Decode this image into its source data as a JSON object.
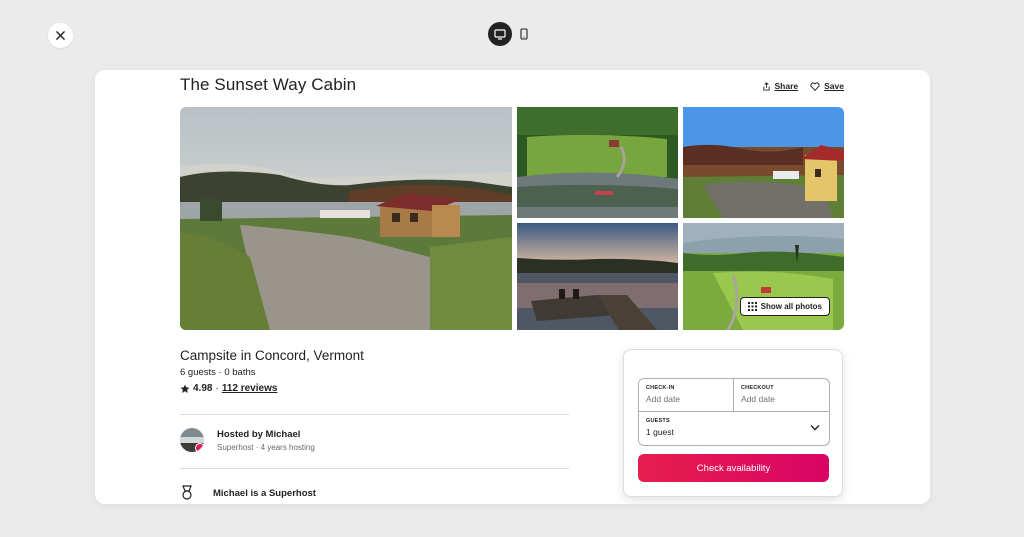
{
  "window": {
    "close_icon": "close-icon",
    "device_toggle": [
      {
        "icon": "desktop-icon",
        "active": true
      },
      {
        "icon": "mobile-icon",
        "active": false
      }
    ]
  },
  "listing": {
    "title": "The Sunset Way Cabin",
    "share_label": "Share",
    "save_label": "Save",
    "show_all_photos_label": "Show all photos",
    "subtitle": "Campsite in Concord, Vermont",
    "details": "6 guests · 0 baths",
    "rating_score": "4.98",
    "rating_separator": "·",
    "reviews_link": "112 reviews",
    "host_name": "Hosted by Michael",
    "host_meta": "Superhost · 4 years hosting",
    "superhost_title": "Michael is a Superhost"
  },
  "booking": {
    "checkin_label": "CHECK-IN",
    "checkin_value": "Add date",
    "checkout_label": "CHECKOUT",
    "checkout_value": "Add date",
    "guests_label": "GUESTS",
    "guests_value": "1 guest",
    "cta_label": "Check availability"
  },
  "colors": {
    "accent": "#e31c5f",
    "text": "#222222",
    "muted": "#717171",
    "background": "#ebebeb"
  }
}
